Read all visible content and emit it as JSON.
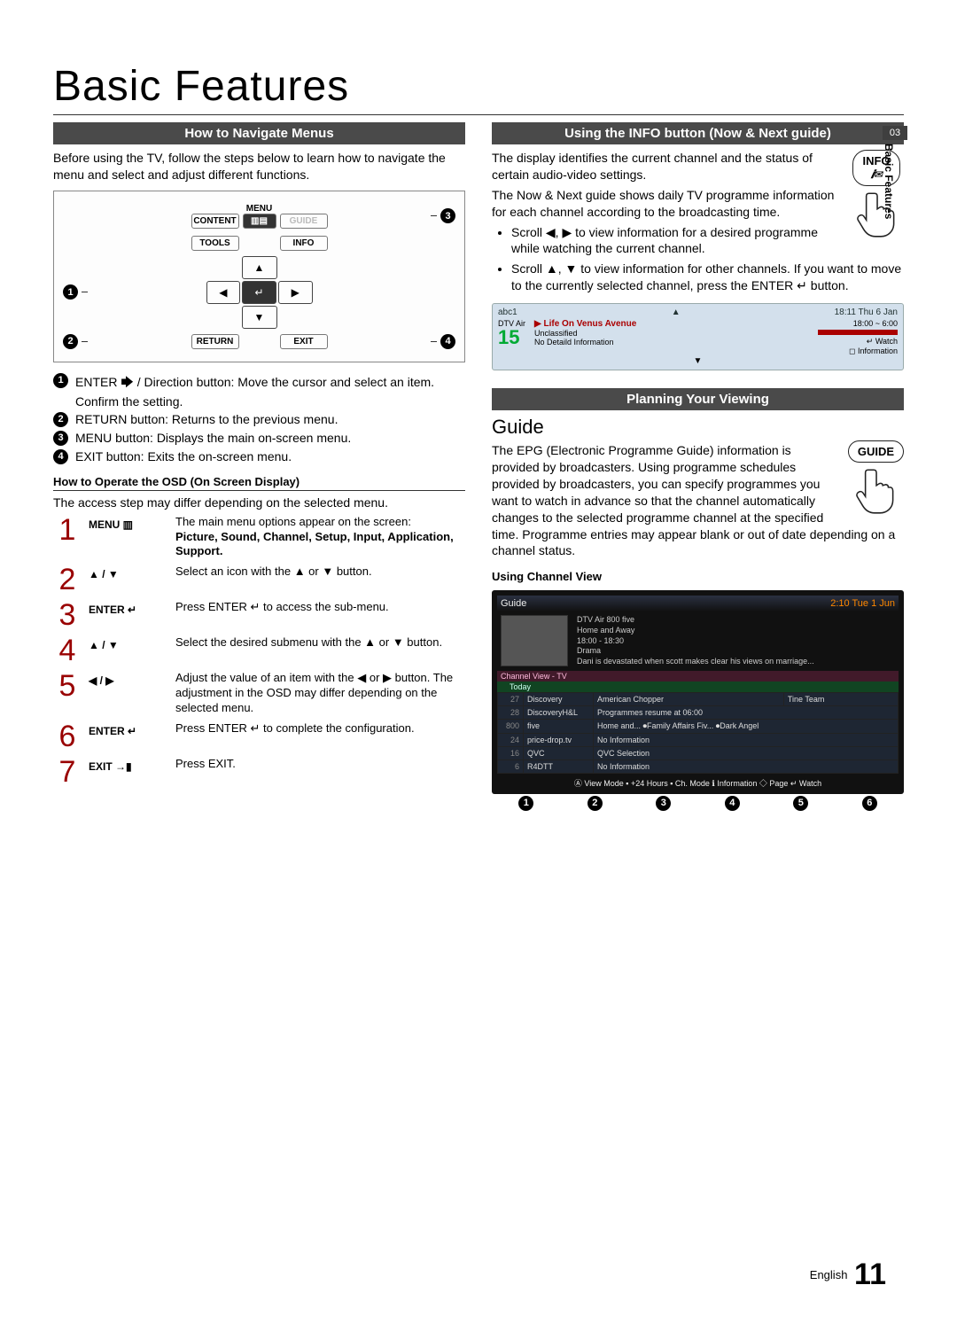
{
  "page": {
    "title": "Basic Features",
    "footer_lang": "English",
    "page_number": "11",
    "side_chapter_num": "03",
    "side_chapter_label": "Basic Features"
  },
  "left": {
    "band_nav": "How to Navigate Menus",
    "intro": "Before using the TV, follow the steps below to learn how to navigate the menu and select and adjust different functions.",
    "remote": {
      "menu": "MENU",
      "content": "CONTENT",
      "tools": "TOOLS",
      "info": "INFO",
      "return": "RETURN",
      "exit": "EXIT"
    },
    "callouts": [
      "ENTER 🡆 / Direction button: Move the cursor and select an item. Confirm the setting.",
      "RETURN button: Returns to the previous menu.",
      "MENU button: Displays the main on-screen menu.",
      "EXIT button: Exits the on-screen menu."
    ],
    "osd_heading": "How to Operate the OSD (On Screen Display)",
    "osd_note": "The access step may differ depending on the selected menu.",
    "osd": [
      {
        "n": "1",
        "btn": "MENU ▥",
        "desc_a": "The main menu options appear on the screen:",
        "desc_b": "Picture, Sound, Channel, Setup, Input, Application, Support."
      },
      {
        "n": "2",
        "btn": "▲ / ▼",
        "desc_a": "Select an icon with the ▲ or ▼ button.",
        "desc_b": ""
      },
      {
        "n": "3",
        "btn": "ENTER ↵",
        "desc_a": "Press ENTER ↵ to access the sub-menu.",
        "desc_b": ""
      },
      {
        "n": "4",
        "btn": "▲ / ▼",
        "desc_a": "Select the desired submenu with the ▲ or ▼ button.",
        "desc_b": ""
      },
      {
        "n": "5",
        "btn": "◀ / ▶",
        "desc_a": "Adjust the value of an item with the ◀ or ▶ button. The adjustment in the OSD may differ depending on the selected menu.",
        "desc_b": ""
      },
      {
        "n": "6",
        "btn": "ENTER ↵",
        "desc_a": "Press ENTER ↵ to complete the configuration.",
        "desc_b": ""
      },
      {
        "n": "7",
        "btn": "EXIT →▮",
        "desc_a": "Press EXIT.",
        "desc_b": ""
      }
    ]
  },
  "right": {
    "band_info": "Using the INFO button (Now & Next guide)",
    "info_p1": "The display identifies the current channel and the status of certain audio-video settings.",
    "info_p2": "The Now & Next guide shows daily TV programme information for each channel according to the broadcasting time.",
    "info_bullets": [
      "Scroll ◀, ▶ to view information for a desired programme while watching the current channel.",
      "Scroll ▲, ▼ to view information for other channels. If you want to move to the currently selected channel, press the ENTER ↵ button."
    ],
    "info_badge": "INFO",
    "nownext": {
      "ch_name": "abc1",
      "clock": "18:11 Thu 6 Jan",
      "src": "DTV Air",
      "ch_num": "15",
      "prog": "Life On Venus Avenue",
      "rating": "Unclassified",
      "detail": "No Detaild Information",
      "time": "18:00 ~ 6:00",
      "watch": "↵ Watch",
      "infoline": "◻ Information"
    },
    "band_plan": "Planning Your Viewing",
    "guide_h": "Guide",
    "guide_badge": "GUIDE",
    "guide_p": "The EPG (Electronic Programme Guide) information is provided by broadcasters. Using programme schedules provided by broadcasters, you can specify programmes you want to watch in advance so that the channel automatically changes to the selected programme channel at the specified time. Programme entries may appear blank or out of date depending on a channel status.",
    "cv_heading": "Using  Channel View",
    "guide_fig": {
      "title": "Guide",
      "clock": "2:10 Tue 1 Jun",
      "prog_title": "DTV Air 800 five",
      "prog_name": "Home and Away",
      "prog_time": "18:00 - 18:30",
      "prog_genre": "Drama",
      "prog_desc": "Dani is devastated when scott makes clear his views on marriage...",
      "view_label": "Channel View - TV",
      "today": "Today",
      "rows": [
        {
          "num": "27",
          "name": "Discovery",
          "c1": "American Chopper",
          "c2": "Tine Team"
        },
        {
          "num": "28",
          "name": "DiscoveryH&L",
          "c1": "Programmes resume at 06:00",
          "c2": ""
        },
        {
          "num": "800",
          "name": "five",
          "c1": "Home and...   ⏺Family Affairs   Fiv...   ⏺Dark Angel",
          "c2": ""
        },
        {
          "num": "24",
          "name": "price-drop.tv",
          "c1": "No Information",
          "c2": ""
        },
        {
          "num": "16",
          "name": "QVC",
          "c1": "QVC Selection",
          "c2": ""
        },
        {
          "num": "6",
          "name": "R4DTT",
          "c1": "No Information",
          "c2": ""
        }
      ],
      "footer": "Ⓐ View Mode  ▪ +24 Hours  ▪ Ch. Mode  ℹ Information  ◇ Page  ↵ Watch"
    }
  }
}
